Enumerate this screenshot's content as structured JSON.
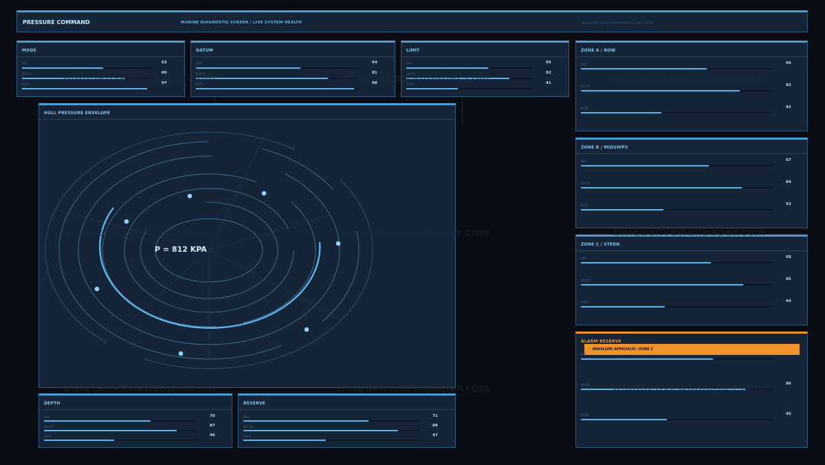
{
  "header": {
    "title": "PRESSURE COMMAND",
    "subtitle": "MARINE DIAGNOSTIC SCREEN / LIVE SYSTEM HEALTH",
    "meta": "MEASURED REPORTED INFERRED / LOOP 00:05"
  },
  "top_panels": [
    {
      "title": "MODE",
      "metrics": [
        {
          "label": "KPA",
          "value": "63",
          "fill": 0.62
        },
        {
          "label": "DELTA",
          "value": "80",
          "fill": 0.79
        },
        {
          "label": "RATE",
          "value": "97",
          "fill": 0.96
        }
      ]
    },
    {
      "title": "DATUM",
      "metrics": [
        {
          "label": "KPA",
          "value": "64",
          "fill": 0.64
        },
        {
          "label": "DELTA",
          "value": "81",
          "fill": 0.81
        },
        {
          "label": "RATE",
          "value": "98",
          "fill": 0.97
        }
      ]
    },
    {
      "title": "LIMIT",
      "metrics": [
        {
          "label": "KPA",
          "value": "65",
          "fill": 0.65
        },
        {
          "label": "DELTA",
          "value": "82",
          "fill": 0.82
        },
        {
          "label": "RATE",
          "value": "41",
          "fill": 0.41
        }
      ]
    }
  ],
  "zones": [
    {
      "title": "ZONE A / BOW",
      "metrics": [
        {
          "label": "KPA",
          "value": "66",
          "fill": 0.66
        },
        {
          "label": "DELTA",
          "value": "83",
          "fill": 0.83
        },
        {
          "label": "RATE",
          "value": "42",
          "fill": 0.42
        }
      ]
    },
    {
      "title": "ZONE B / MIDSHIPS",
      "metrics": [
        {
          "label": "KPA",
          "value": "67",
          "fill": 0.67
        },
        {
          "label": "DELTA",
          "value": "84",
          "fill": 0.84
        },
        {
          "label": "RATE",
          "value": "43",
          "fill": 0.43
        }
      ]
    },
    {
      "title": "ZONE C / STERN",
      "metrics": [
        {
          "label": "KPA",
          "value": "68",
          "fill": 0.68
        },
        {
          "label": "DELTA",
          "value": "85",
          "fill": 0.85
        },
        {
          "label": "RATE",
          "value": "44",
          "fill": 0.44
        }
      ]
    }
  ],
  "alarm": {
    "title": "ALARM RESERVE",
    "banner": "ENVELOPE APPROACH / ZONE C",
    "metrics": [
      {
        "label": "KPA",
        "value": "",
        "fill": 0.69
      },
      {
        "label": "DELTA",
        "value": "86",
        "fill": 0.86
      },
      {
        "label": "RATE",
        "value": "45",
        "fill": 0.45
      }
    ]
  },
  "envelope": {
    "title": "HULL PRESSURE ENVELOPE",
    "readout": "P = 812 KPA"
  },
  "bottom_panels": [
    {
      "title": "DEPTH",
      "metrics": [
        {
          "label": "KPA",
          "value": "70",
          "fill": 0.7
        },
        {
          "label": "DELTA",
          "value": "87",
          "fill": 0.87
        },
        {
          "label": "RATE",
          "value": "46",
          "fill": 0.46
        }
      ]
    },
    {
      "title": "RESERVE",
      "metrics": [
        {
          "label": "KPA",
          "value": "71",
          "fill": 0.71
        },
        {
          "label": "DELTA",
          "value": "88",
          "fill": 0.88
        },
        {
          "label": "RATE",
          "value": "47",
          "fill": 0.47
        }
      ]
    }
  ],
  "watermark": "uniquelivewallpaper.com",
  "colors": {
    "accent": "#5db3ec",
    "alarm": "#f0932c",
    "panel": "#152537",
    "background": "#0a0e14"
  }
}
